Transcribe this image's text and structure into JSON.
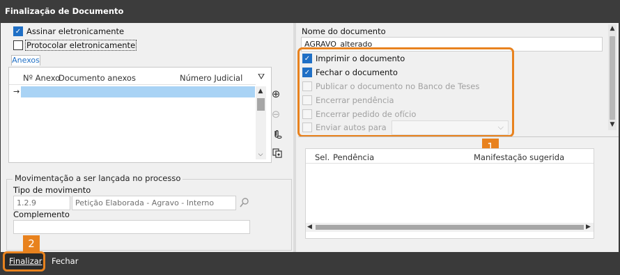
{
  "window": {
    "title": "Finalização de Documento"
  },
  "left": {
    "sign_label": "Assinar eletronicamente",
    "protocol_label": "Protocolar eletronicamente",
    "tab_label": "Anexos",
    "columns": [
      "Nº Anexo",
      "Documento anexos",
      "Número Judicial"
    ],
    "row_marker": "→",
    "scroll_up": "▲",
    "scroll_down": "⌵",
    "icons": [
      "add-icon",
      "remove-icon",
      "attach-icon",
      "copy-icon",
      "filter-icon"
    ]
  },
  "movement": {
    "group_title": "Movimentação a ser lançada no processo",
    "type_label": "Tipo de movimento",
    "type_code": "1.2.9",
    "type_name": "Petição Elaborada - Agravo - Interno",
    "complement_label": "Complemento",
    "complement_value": ""
  },
  "right": {
    "doc_name_label": "Nome do documento",
    "doc_name_value": "AGRAVO_alterado",
    "options": [
      {
        "label": "Imprimir o documento",
        "checked": true,
        "enabled": true
      },
      {
        "label": "Fechar o documento",
        "checked": true,
        "enabled": true
      },
      {
        "label": "Publicar o documento no Banco de Teses",
        "checked": false,
        "enabled": false
      },
      {
        "label": "Encerrar pendência",
        "checked": false,
        "enabled": false
      },
      {
        "label": "Encerrar pedido de ofício",
        "checked": false,
        "enabled": false
      },
      {
        "label": "Enviar autos para",
        "checked": false,
        "enabled": false
      }
    ],
    "send_to_value": "",
    "pend_columns": [
      "Sel.",
      "Pendência",
      "Manifestação sugerida"
    ]
  },
  "badges": {
    "one": "1",
    "two": "2"
  },
  "footer": {
    "finalize_label": "Finalizar",
    "close_label": "Fechar"
  },
  "colors": {
    "accent": "#e8821e",
    "check": "#1f6fc5",
    "selection": "#a9d3f5"
  }
}
